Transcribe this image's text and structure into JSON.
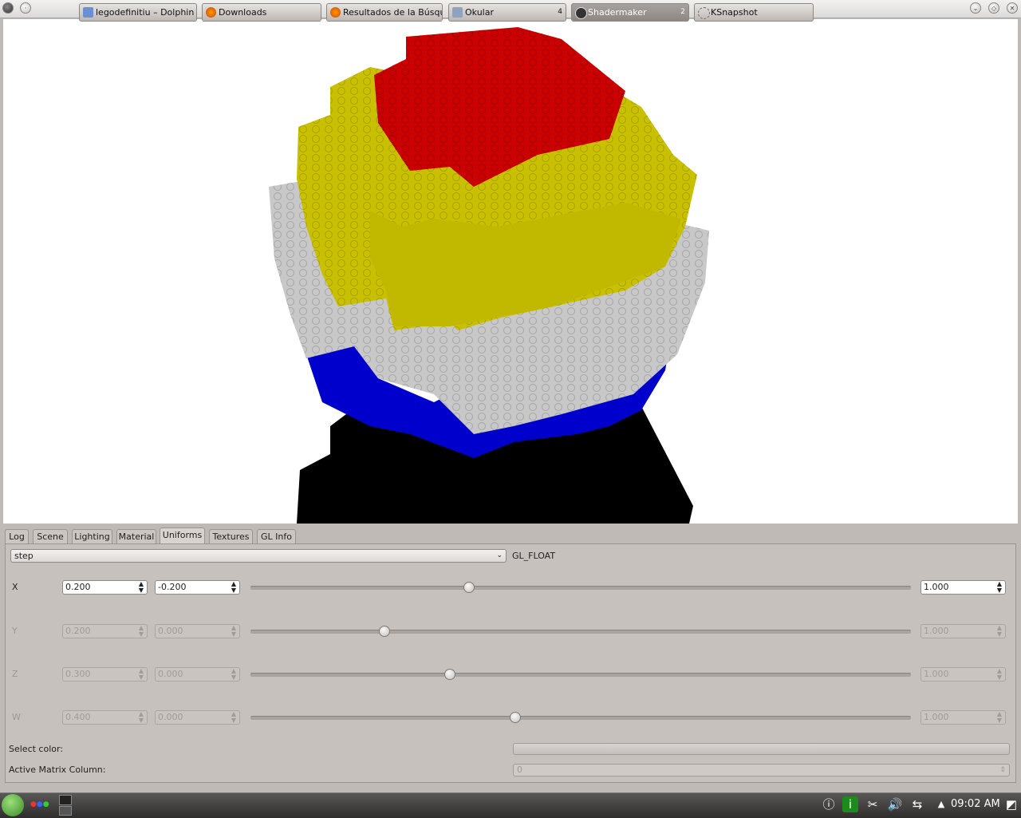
{
  "window": {
    "title": "Shader Maker"
  },
  "tabs": [
    {
      "label": "Log"
    },
    {
      "label": "Scene"
    },
    {
      "label": "Lighting"
    },
    {
      "label": "Material"
    },
    {
      "label": "Uniforms"
    },
    {
      "label": "Textures"
    },
    {
      "label": "GL Info"
    }
  ],
  "active_tab": "Uniforms",
  "uniform": {
    "name": "step",
    "type": "GL_FLOAT"
  },
  "rows": [
    {
      "label": "X",
      "value": "0.200",
      "min": "-0.200",
      "max": "1.000",
      "slider_fraction": 0.333,
      "enabled": true
    },
    {
      "label": "Y",
      "value": "0.200",
      "min": "0.000",
      "max": "1.000",
      "slider_fraction": 0.203,
      "enabled": false
    },
    {
      "label": "Z",
      "value": "0.300",
      "min": "0.000",
      "max": "1.000",
      "slider_fraction": 0.302,
      "enabled": false
    },
    {
      "label": "W",
      "value": "0.400",
      "min": "0.000",
      "max": "1.000",
      "slider_fraction": 0.401,
      "enabled": false
    }
  ],
  "select_color_label": "Select color:",
  "active_matrix_label": "Active Matrix Column:",
  "active_matrix_value": "0",
  "taskbar": {
    "tasks": [
      {
        "label": "legodefinitiu – Dolphin",
        "num": ""
      },
      {
        "label": "Downloads",
        "num": ""
      },
      {
        "label": "Resultados de la Búsque",
        "num": ""
      },
      {
        "label": "Okular",
        "num": "4"
      },
      {
        "label": "Shadermaker",
        "num": "2"
      },
      {
        "label": "KSnapshot",
        "num": ""
      }
    ],
    "clock": "09:02 AM"
  },
  "colors": {
    "red": "#cc0000",
    "yellow": "#c8c000",
    "white_brick": "#c8c8c8",
    "blue": "#0000cc",
    "shadow": "#000000"
  }
}
